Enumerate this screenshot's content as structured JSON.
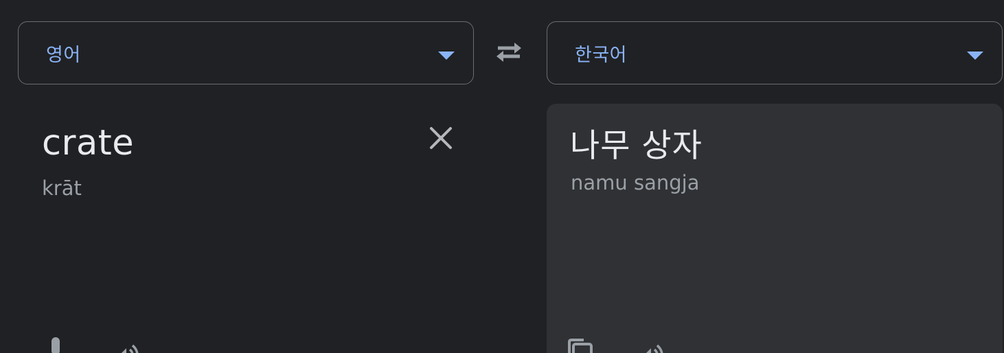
{
  "source_language": {
    "label": "영어",
    "icon": "caret-down-icon"
  },
  "target_language": {
    "label": "한국어",
    "icon": "caret-down-icon"
  },
  "swap": {
    "icon": "swap-arrows-icon"
  },
  "source": {
    "text": "crate",
    "transliteration": "krāt",
    "clear_icon": "close-icon",
    "mic_icon": "microphone-icon",
    "listen_icon": "speaker-icon"
  },
  "target": {
    "text": "나무 상자",
    "transliteration": "namu sangja",
    "copy_icon": "copy-icon",
    "listen_icon": "speaker-icon"
  },
  "colors": {
    "background": "#202124",
    "panel": "#303134",
    "accent": "#8ab4f8",
    "text_primary": "#e8eaed",
    "text_secondary": "#9aa0a6",
    "icon": "#9aa0a6"
  }
}
